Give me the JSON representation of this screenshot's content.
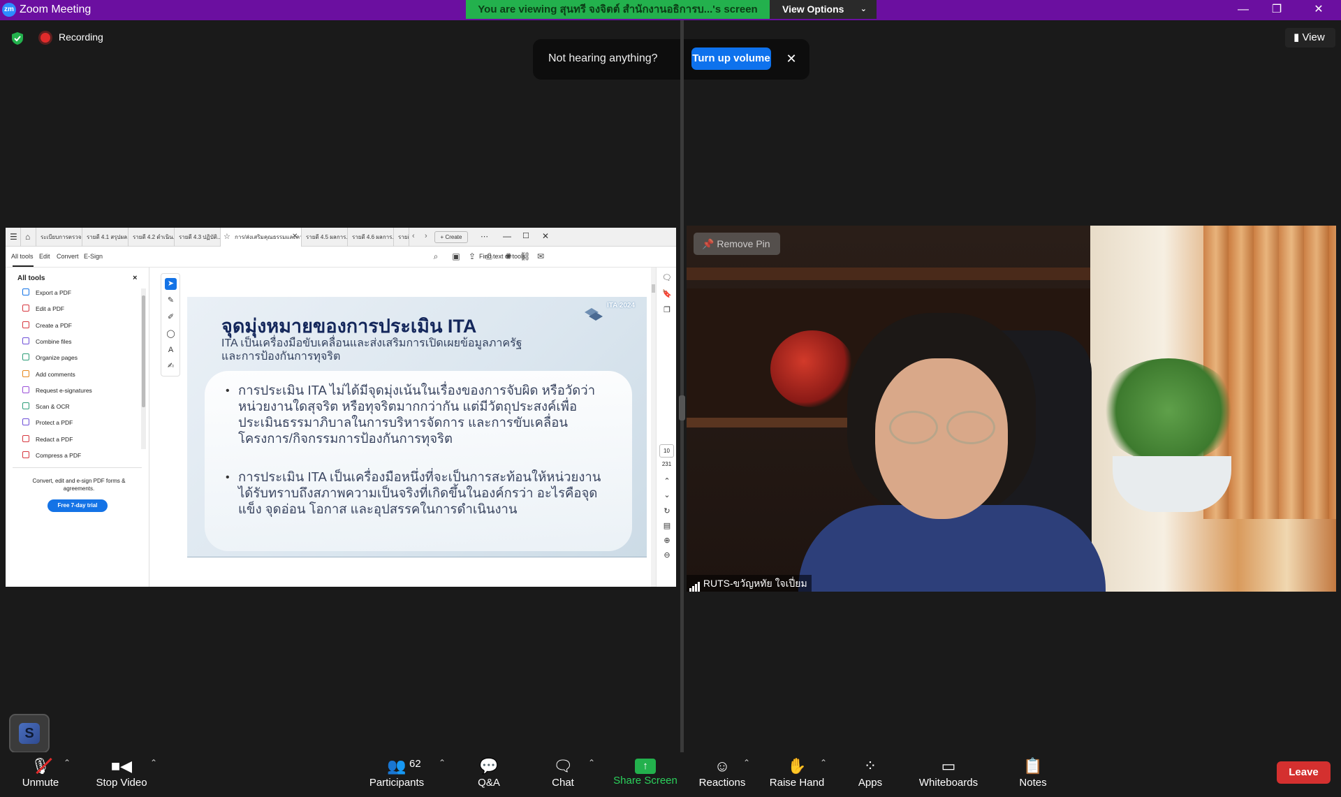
{
  "window": {
    "title": "Zoom Meeting",
    "logo_text": "zm",
    "viewing_banner": "You are viewing สุนทรี จงจิตต์ สำนักงานอธิการบ...'s screen",
    "view_options": "View Options",
    "controls": {
      "minimize": "—",
      "restore": "❐",
      "close": "✕"
    }
  },
  "status": {
    "recording": "Recording",
    "view": "View"
  },
  "audio_prompt": {
    "message": "Not hearing anything?",
    "action": "Turn up volume",
    "close": "✕"
  },
  "acrobat": {
    "tabs": [
      "ระเบียบการตรวจ...",
      "รายดี 4.1 สรุปผล...",
      "รายดี 4.2 ดำเนิน...",
      "รายดี 4.3 ปฏิบัติ...",
      "การ/ส่งเสริมคุณธรรมและความโ...",
      "รายดี 4.5 ผลการ...",
      "รายดี 4.6 ผลการ...",
      "รายดี"
    ],
    "active_tab_close": "✕",
    "new_tab": "+ Create",
    "menu": [
      "All tools",
      "Edit",
      "Convert",
      "E-Sign"
    ],
    "find": "Find text or tools",
    "left_panel": {
      "title": "All tools",
      "close": "×",
      "tools": [
        {
          "label": "Export a PDF",
          "color": "#1473e6"
        },
        {
          "label": "Edit a PDF",
          "color": "#d7373f"
        },
        {
          "label": "Create a PDF",
          "color": "#d7373f"
        },
        {
          "label": "Combine files",
          "color": "#6e4fd8"
        },
        {
          "label": "Organize pages",
          "color": "#2d9d78"
        },
        {
          "label": "Add comments",
          "color": "#e68619"
        },
        {
          "label": "Request e-signatures",
          "color": "#9a4fd8"
        },
        {
          "label": "Scan & OCR",
          "color": "#2d9d78"
        },
        {
          "label": "Protect a PDF",
          "color": "#6e4fd8"
        },
        {
          "label": "Redact a PDF",
          "color": "#d7373f"
        },
        {
          "label": "Compress a PDF",
          "color": "#d7373f"
        }
      ],
      "promo": "Convert, edit and e-sign PDF forms & agreements.",
      "trial": "Free 7-day trial"
    },
    "slide": {
      "title": "จุดมุ่งหมายของการประเมิน ITA",
      "subtitle_line1": "ITA เป็นเครื่องมือขับเคลื่อนและส่งเสริมการเปิดเผยข้อมูลภาครัฐ",
      "subtitle_line2": "และการป้องกันการทุจริต",
      "logo_text": "ITA 2024",
      "bullets": [
        "การประเมิน ITA ไม่ได้มีจุดมุ่งเน้นในเรื่องของการจับผิด หรือวัดว่าหน่วยงานใดสุจริต หรือทุจริตมากกว่ากัน แต่มีวัตถุประสงค์เพื่อประเมินธรรมาภิบาลในการบริหารจัดการ และการขับเคลื่อนโครงการ/กิจกรรมการป้องกันการทุจริต",
        "การประเมิน ITA เป็นเครื่องมือหนึ่งที่จะเป็นการสะท้อนให้หน่วยงานได้รับทราบถึงสภาพความเป็นจริงที่เกิดขึ้นในองค์กรว่า อะไรคือจุดแข็ง จุดอ่อน โอกาส และอุปสรรคในการดำเนินงาน"
      ]
    },
    "page_current": "10",
    "page_total": "231"
  },
  "video": {
    "remove_pin": "Remove Pin",
    "participant_name": "RUTS-ขวัญหทัย ใจเปี่ยม"
  },
  "toolbar": {
    "unmute": "Unmute",
    "stop_video": "Stop Video",
    "participants": "Participants",
    "participant_count": "62",
    "qa": "Q&A",
    "chat": "Chat",
    "share_screen": "Share Screen",
    "reactions": "Reactions",
    "raise_hand": "Raise Hand",
    "apps": "Apps",
    "whiteboards": "Whiteboards",
    "notes": "Notes",
    "leave": "Leave"
  },
  "colors": {
    "titlebar": "#6b0fa0",
    "banner": "#23b14d",
    "primary_button": "#0e72ed",
    "leave": "#d4302f"
  }
}
